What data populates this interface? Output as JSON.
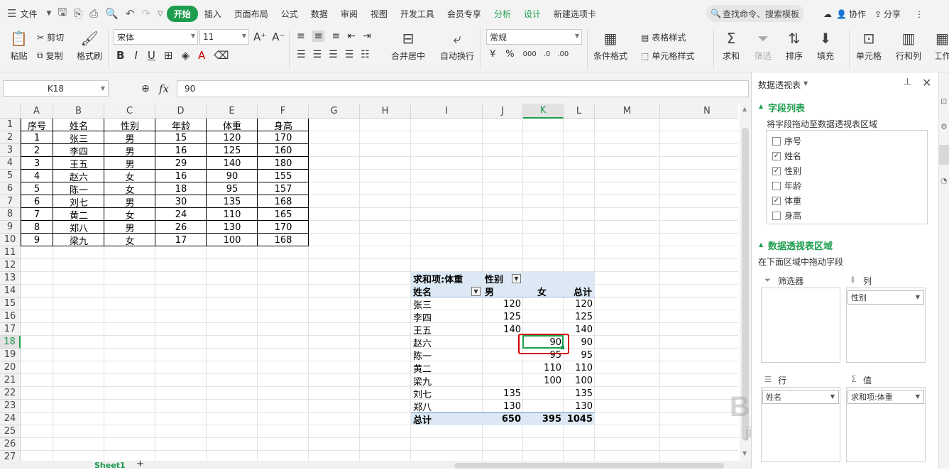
{
  "menu": {
    "file": "文件",
    "tabs": [
      "开始",
      "插入",
      "页面布局",
      "公式",
      "数据",
      "审阅",
      "视图",
      "开发工具",
      "会员专享",
      "分析",
      "设计",
      "新建选项卡"
    ],
    "search": "查找命令、搜索模板",
    "collab": "协作",
    "share": "分享"
  },
  "ribbon": {
    "paste": "粘贴",
    "cut": "剪切",
    "copy": "复制",
    "format_painter": "格式刷",
    "font_name": "宋体",
    "font_size": "11",
    "number_format": "常规",
    "merge": "合并居中",
    "wrap": "自动换行",
    "cond_format": "条件格式",
    "table_style": "表格样式",
    "cell_style": "单元格样式",
    "sum": "求和",
    "filter": "筛选",
    "sort": "排序",
    "fill": "填充",
    "cell": "单元格",
    "rowcol": "行和列",
    "worksheet": "工作"
  },
  "formula": {
    "name_box": "K18",
    "fx": "fx",
    "value": "90"
  },
  "columns": [
    "A",
    "B",
    "C",
    "D",
    "E",
    "F",
    "G",
    "H",
    "I",
    "J",
    "K",
    "L",
    "M",
    "N"
  ],
  "rows": [
    "1",
    "2",
    "3",
    "4",
    "5",
    "6",
    "7",
    "8",
    "9",
    "10",
    "11",
    "12",
    "13",
    "14",
    "15",
    "16",
    "17",
    "18",
    "19",
    "20",
    "21",
    "22",
    "23",
    "24",
    "25",
    "26",
    "27"
  ],
  "table": {
    "headers": [
      "序号",
      "姓名",
      "性别",
      "年龄",
      "体重",
      "身高"
    ],
    "rows": [
      [
        "1",
        "张三",
        "男",
        "15",
        "120",
        "170"
      ],
      [
        "2",
        "李四",
        "男",
        "16",
        "125",
        "160"
      ],
      [
        "3",
        "王五",
        "男",
        "29",
        "140",
        "180"
      ],
      [
        "4",
        "赵六",
        "女",
        "16",
        "90",
        "155"
      ],
      [
        "5",
        "陈一",
        "女",
        "18",
        "95",
        "157"
      ],
      [
        "6",
        "刘七",
        "男",
        "30",
        "135",
        "168"
      ],
      [
        "7",
        "黄二",
        "女",
        "24",
        "110",
        "165"
      ],
      [
        "8",
        "郑八",
        "男",
        "26",
        "130",
        "170"
      ],
      [
        "9",
        "梁九",
        "女",
        "17",
        "100",
        "168"
      ]
    ]
  },
  "pivot": {
    "title": "求和项:体重",
    "col_field": "性别",
    "row_field": "姓名",
    "col_labels": [
      "男",
      "女",
      "总计"
    ],
    "rows": [
      [
        "张三",
        "120",
        "",
        "120"
      ],
      [
        "李四",
        "125",
        "",
        "125"
      ],
      [
        "王五",
        "140",
        "",
        "140"
      ],
      [
        "赵六",
        "",
        "90",
        "90"
      ],
      [
        "陈一",
        "",
        "95",
        "95"
      ],
      [
        "黄二",
        "",
        "110",
        "110"
      ],
      [
        "梁九",
        "",
        "100",
        "100"
      ],
      [
        "刘七",
        "135",
        "",
        "135"
      ],
      [
        "郑八",
        "130",
        "",
        "130"
      ]
    ],
    "total": [
      "总计",
      "650",
      "395",
      "1045"
    ]
  },
  "sheet_tab": "Sheet1",
  "panel": {
    "title": "数据透视表",
    "section_fields": "字段列表",
    "fields_hint": "将字段拖动至数据透视表区域",
    "fields": [
      {
        "name": "序号",
        "checked": false
      },
      {
        "name": "姓名",
        "checked": true
      },
      {
        "name": "性别",
        "checked": true
      },
      {
        "name": "年龄",
        "checked": false
      },
      {
        "name": "体重",
        "checked": true
      },
      {
        "name": "身高",
        "checked": false
      }
    ],
    "section_area": "数据透视表区域",
    "area_hint": "在下面区域中拖动字段",
    "filter_label": "筛选器",
    "col_label": "列",
    "col_chip": "性别",
    "row_label": "行",
    "val_label": "值",
    "row_chip": "姓名",
    "val_chip": "求和项:体重"
  },
  "watermark": {
    "main": "Baidu经验",
    "sub": "jingyan.baidu.com"
  },
  "colors": {
    "accent": "#1e9d4f",
    "selection": "#d00000",
    "pivot_header": "#dce9f5"
  }
}
